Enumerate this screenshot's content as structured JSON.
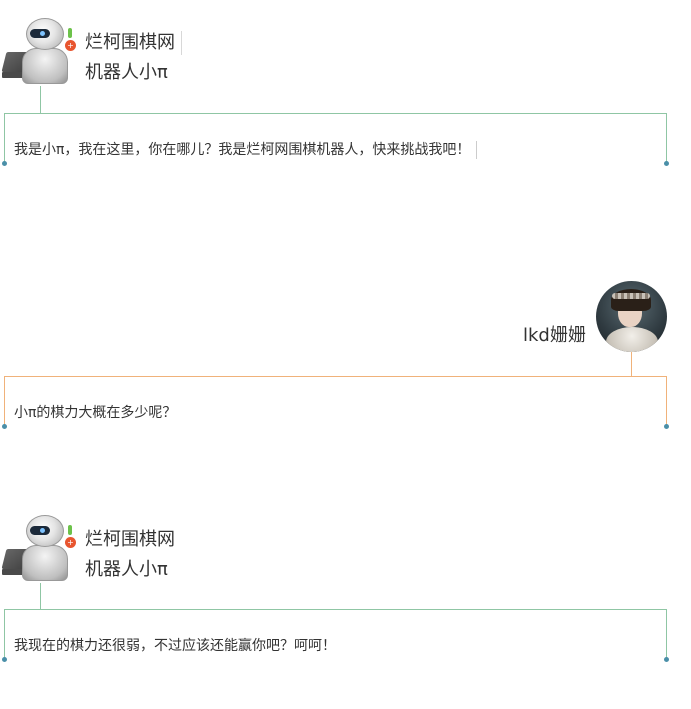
{
  "messages": [
    {
      "sender": "robot",
      "site_name": "烂柯围棋网",
      "bot_name": "机器人小π",
      "text": "我是小π，我在这里，你在哪儿？我是烂柯网围棋机器人，快来挑战我吧！"
    },
    {
      "sender": "user",
      "user_name": "lkd姗姗",
      "text": "小π的棋力大概在多少呢？"
    },
    {
      "sender": "robot",
      "site_name": "烂柯围棋网",
      "bot_name": "机器人小π",
      "text": "我现在的棋力还很弱，不过应该还能赢你吧？呵呵！"
    }
  ],
  "colors": {
    "robot_line": "#8fc6a4",
    "user_line": "#f0b27a",
    "dot": "#4a8fa8",
    "text": "#333333"
  },
  "icons": {
    "robot_avatar": "robot-avatar-icon",
    "user_avatar": "user-avatar-photo"
  }
}
